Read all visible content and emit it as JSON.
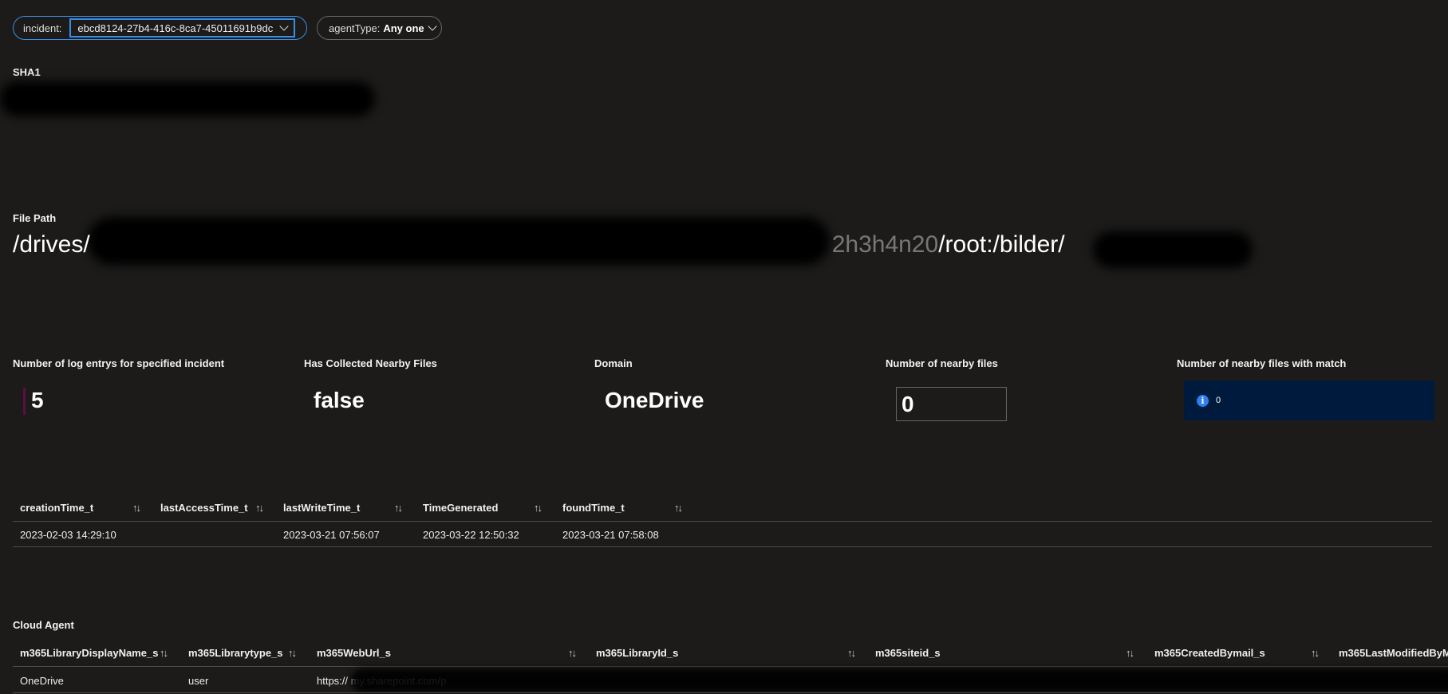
{
  "filters": {
    "incident": {
      "label": "incident:",
      "value": "ebcd8124-27b4-416c-8ca7-45011691b9dc"
    },
    "agent_type": {
      "label": "agentType:",
      "value": "Any one"
    }
  },
  "sha1": {
    "label": "SHA1"
  },
  "file_path": {
    "label": "File Path",
    "prefix": "/drives/",
    "middle": "2h3h4n20",
    "suffix": "/root:/bilder/"
  },
  "metrics": [
    {
      "label": "Number of log entrys for specified incident",
      "value": "5"
    },
    {
      "label": "Has Collected Nearby Files",
      "value": "false"
    },
    {
      "label": "Domain",
      "value": "OneDrive"
    },
    {
      "label": "Number of nearby files",
      "value": "0"
    },
    {
      "label": "Number of nearby files with match",
      "value": "0"
    }
  ],
  "times_table": {
    "columns": [
      "creationTime_t",
      "lastAccessTime_t",
      "lastWriteTime_t",
      "TimeGenerated",
      "foundTime_t"
    ],
    "rows": [
      [
        "2023-02-03 14:29:10",
        "",
        "2023-03-21 07:56:07",
        "2023-03-22 12:50:32",
        "2023-03-21 07:58:08"
      ]
    ]
  },
  "cloud_agent": {
    "title": "Cloud Agent",
    "columns": [
      "m365LibraryDisplayName_s",
      "m365Librarytype_s",
      "m365WebUrl_s",
      "m365LibraryId_s",
      "m365siteid_s",
      "m365CreatedBymail_s",
      "m365LastModifiedByM"
    ],
    "rows": [
      [
        "OneDrive",
        "user",
        "https://        my.sharepoint.com/p",
        "",
        "",
        "",
        ""
      ]
    ]
  },
  "sort_icon": "↑↓",
  "colors": {
    "accent": "#3a8ee6",
    "info_bg": "#001a3d",
    "info_icon": "#2f7ff0"
  }
}
